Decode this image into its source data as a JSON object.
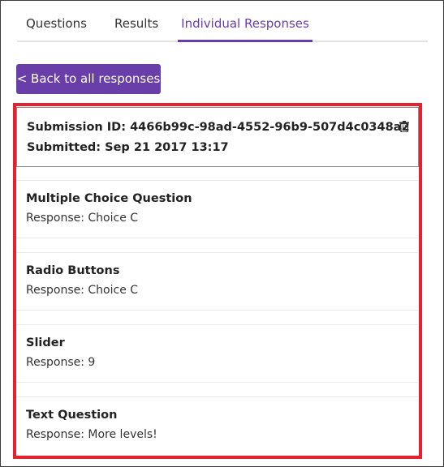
{
  "tabs": {
    "questions": "Questions",
    "results": "Results",
    "individual": "Individual Responses"
  },
  "back_button": "< Back to all responses",
  "submission": {
    "id_line": "Submission ID: 4466b99c-98ad-4552-96b9-507d4c0348a2",
    "submitted_line": "Submitted: Sep 21 2017 13:17",
    "delete_icon": "trash-icon"
  },
  "responses": [
    {
      "question": "Multiple Choice Question",
      "response": "Response: Choice C"
    },
    {
      "question": "Radio Buttons",
      "response": "Response: Choice C"
    },
    {
      "question": "Slider",
      "response": "Response: 9"
    },
    {
      "question": "Text Question",
      "response": "Response: More levels!"
    }
  ],
  "colors": {
    "accent": "#6a3ea8",
    "highlight": "#e4212e"
  }
}
